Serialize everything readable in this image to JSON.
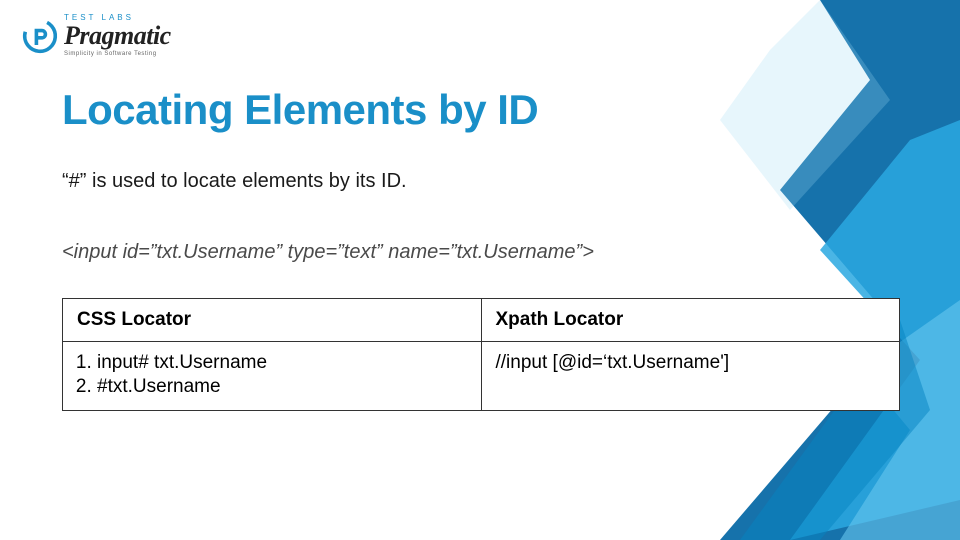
{
  "logo": {
    "top_label": "TEST LABS",
    "word": "Pragmatic",
    "tagline": "Simplicity in Software Testing"
  },
  "title": "Locating Elements by ID",
  "description": "“#” is used to locate elements by its ID.",
  "code_example": "<input id=”txt.Username” type=”text” name=”txt.Username”>",
  "table": {
    "headers": {
      "css": "CSS Locator",
      "xpath": "Xpath Locator"
    },
    "css_items": {
      "0": "input# txt.Username",
      "1": "#txt.Username"
    },
    "xpath_value": "//input [@id=‘txt.Username']"
  }
}
